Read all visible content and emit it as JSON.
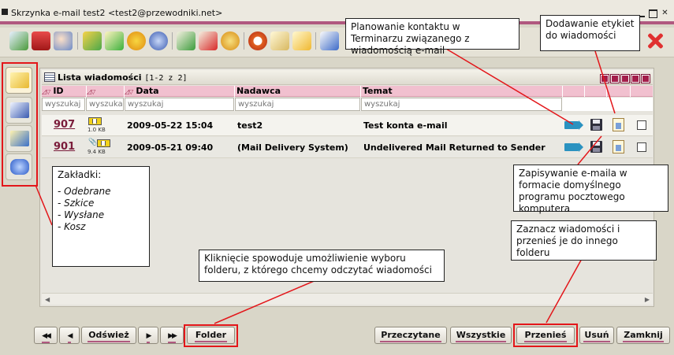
{
  "window": {
    "title": "Skrzynka e-mail test2 <test2@przewodniki.net>"
  },
  "toolbar": {
    "icons": [
      "receive-mail-icon",
      "mailbox-icon",
      "hand-icon",
      "forward-icon",
      "new-mail-icon",
      "chat-icon",
      "at-sign-icon",
      "read-icon",
      "delete-icon",
      "settings-icon",
      "clock-icon",
      "notes-icon",
      "clipboard-icon",
      "edit-icon",
      "close-icon"
    ]
  },
  "sidebar": {
    "tabs": [
      "inbox-tab",
      "drafts-tab",
      "sent-tab",
      "trash-tab"
    ]
  },
  "list": {
    "title": "Lista wiadomości",
    "count": "[1-2 z 2]",
    "columns": [
      "ID",
      "Data",
      "Nadawca",
      "Temat"
    ],
    "search_placeholder": "wyszukaj",
    "search_placeholder_short": "wyszuka",
    "rows": [
      {
        "id": "907",
        "size": "1.0 KB",
        "date": "2009-05-22 15:04",
        "sender": "test2",
        "subject": "Test konta e-mail",
        "attachment": false
      },
      {
        "id": "901",
        "size": "9.4 KB",
        "date": "2009-05-21 09:40",
        "sender": "(Mail Delivery System)",
        "subject": "Undelivered Mail Returned to Sender",
        "attachment": true
      }
    ]
  },
  "buttons": {
    "refresh": "Odśwież",
    "folder": "Folder",
    "read": "Przeczytane",
    "all": "Wszystkie",
    "move": "Przenieś",
    "delete": "Usuń",
    "close": "Zamknij"
  },
  "callouts": {
    "terminarz": "Planowanie kontaktu w Terminarzu związanego z wiadomością e-mail",
    "labels": "Dodawanie etykiet do wiadomości",
    "save": "Zapisywanie e-maila w formacie domyślnego programu pocztowego komputera",
    "tabs_title": "Zakładki:",
    "tabs_items": [
      "- Odebrane",
      "- Szkice",
      "- Wysłane",
      "- Kosz"
    ],
    "folder": "Kliknięcie spowoduje umożliwienie wyboru folderu, z którego chcemy odczytać wiadomości",
    "move": "Zaznacz wiadomości i przenieś je do innego folderu"
  },
  "colors": {
    "accent": "#b0587f",
    "header_pink": "#f1c0cf",
    "highlight_red": "#e3161a"
  }
}
